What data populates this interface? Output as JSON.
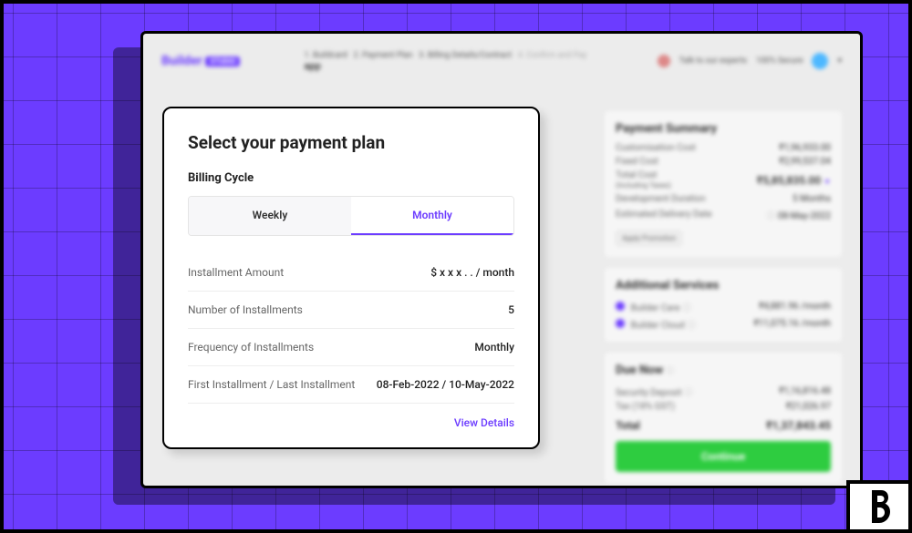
{
  "header": {
    "brand": "Builder",
    "brand_tag": "STUDIO",
    "steps": {
      "s1": "1. Buildcard",
      "s2": "2. Payment Plan",
      "s3": "3. Billing Details/Contract",
      "s4": "4. Confirm and Pay",
      "sub": "app"
    },
    "talk_to_experts": "Talk to our experts",
    "secure_badge": "100% Secure"
  },
  "modal": {
    "title": "Select your payment plan",
    "cycle_heading": "Billing Cycle",
    "tabs": {
      "weekly": "Weekly",
      "monthly": "Monthly"
    },
    "rows": [
      {
        "label": "Installment Amount",
        "value": "$ x x x . . / month"
      },
      {
        "label": "Number of Installments",
        "value": "5"
      },
      {
        "label": "Frequency of Installments",
        "value": "Monthly"
      },
      {
        "label": "First Installment / Last Installment",
        "value": "08-Feb-2022 / 10-May-2022"
      }
    ],
    "view_details": "View Details"
  },
  "summary": {
    "heading": "Payment Summary",
    "rows": [
      {
        "label": "Customisation Cost",
        "value": "₹1,96,933.00"
      },
      {
        "label": "Fixed Cost",
        "value": "₹2,99,537.04"
      }
    ],
    "total_label": "Total Cost\n(Including Taxes)",
    "total_label_line1": "Total Cost",
    "total_label_line2": "(Including Taxes)",
    "total_value": "₹5,85,835.00",
    "extra_rows": [
      {
        "label": "Development Duration",
        "value": "5 Months"
      },
      {
        "label": "Estimated Delivery Date",
        "value": "08-May-2022"
      }
    ],
    "promo_button": "Apply Promotion"
  },
  "services": {
    "heading": "Additional Services",
    "items": [
      {
        "name": "Builder Care",
        "price": "₹4,881.96 /month"
      },
      {
        "name": "Builder Cloud",
        "price": "₹11,075.16 /month"
      }
    ]
  },
  "due": {
    "heading": "Due Now",
    "rows": [
      {
        "label": "Security Deposit",
        "value": "₹1,16,816.48"
      },
      {
        "label": "Tax (18% GST)",
        "value": "₹21,026.97"
      }
    ],
    "total_label": "Total",
    "total_value": "₹1,37,843.45",
    "continue": "Continue"
  }
}
